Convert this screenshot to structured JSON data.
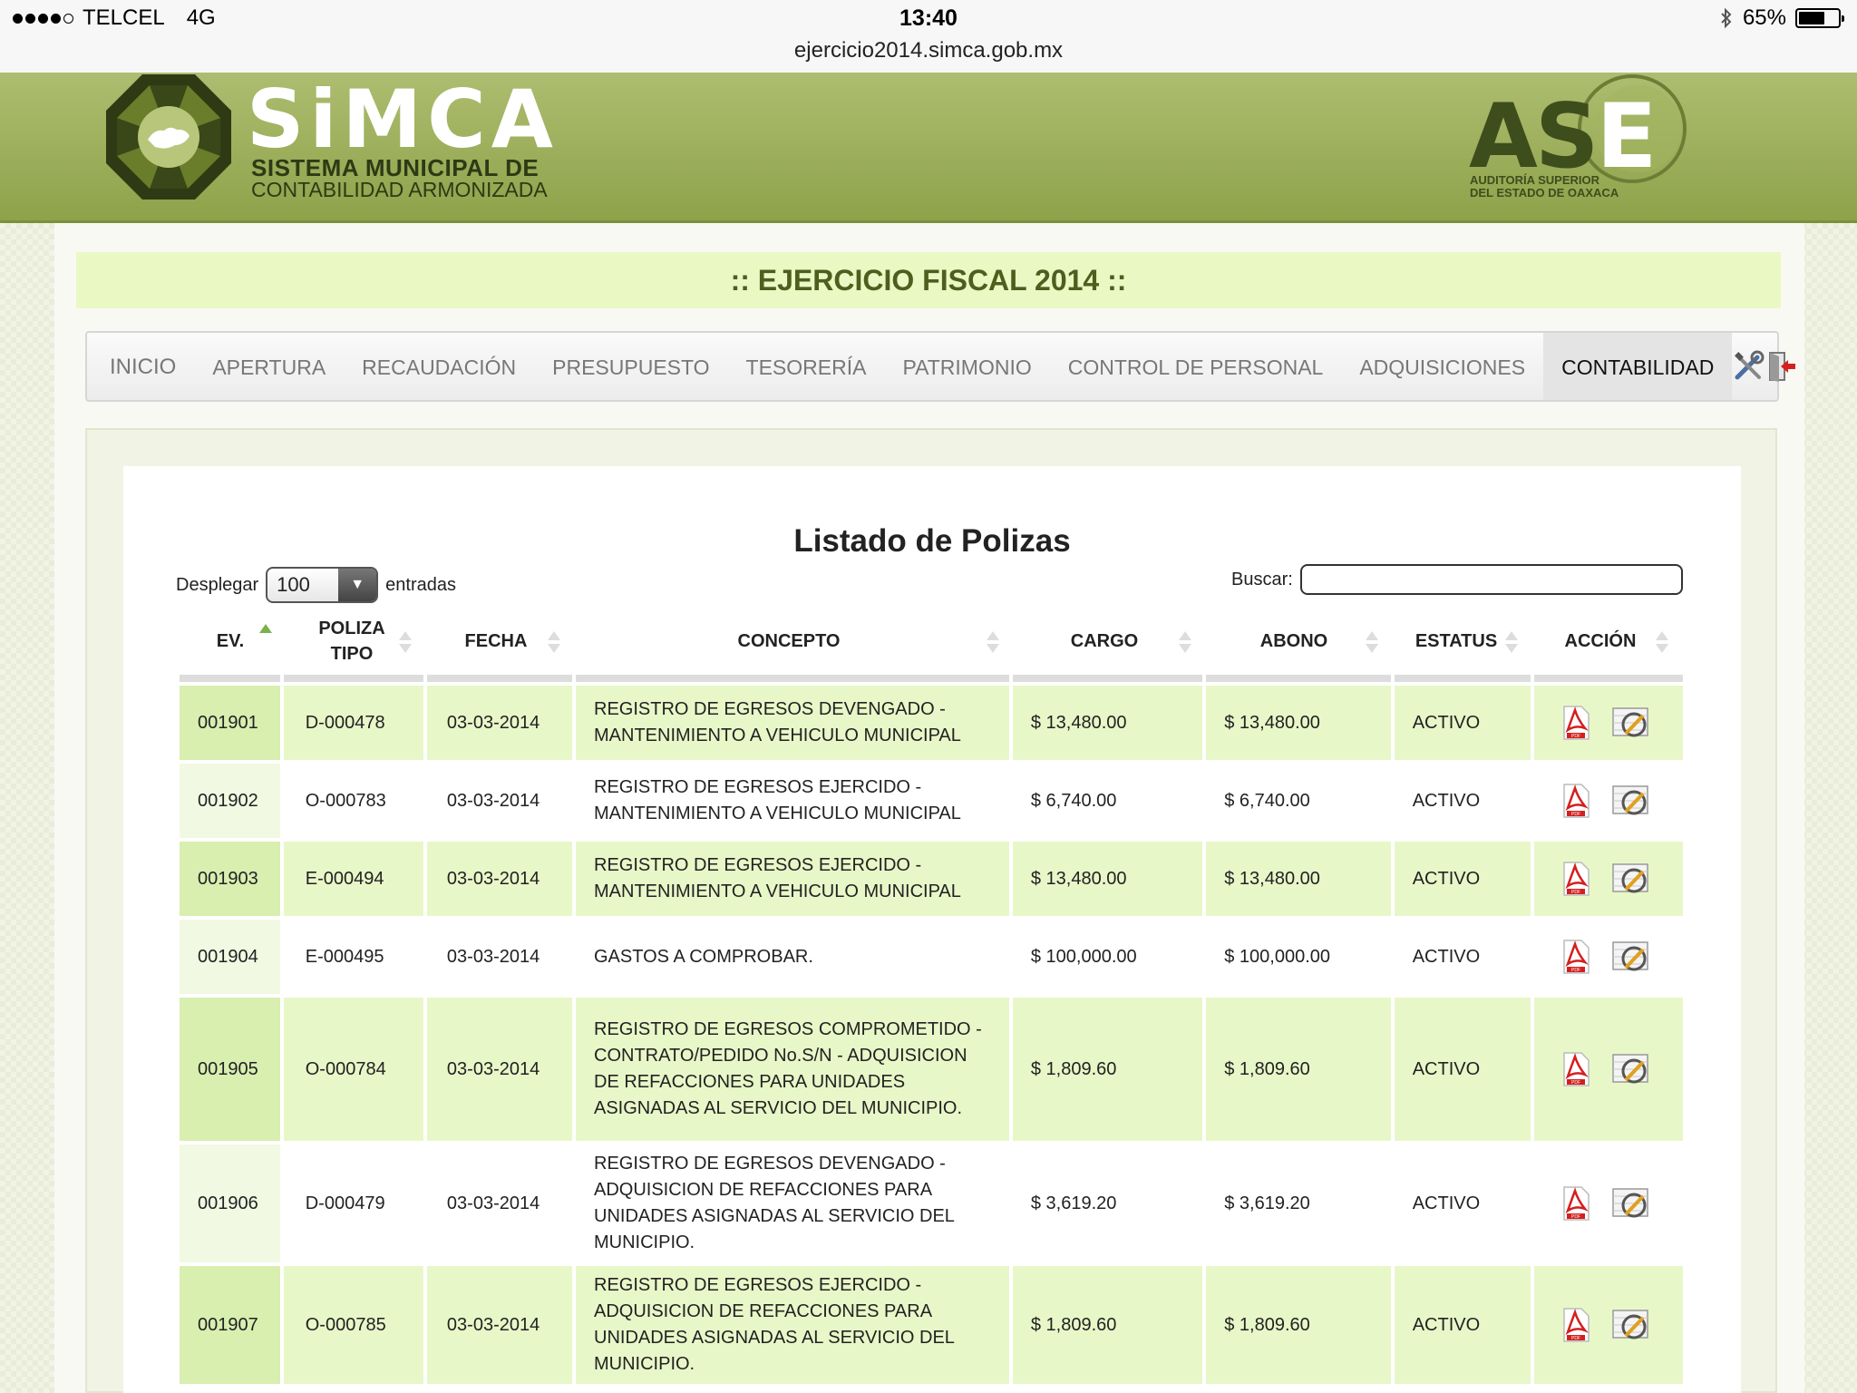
{
  "status_bar": {
    "carrier": "TELCEL",
    "network": "4G",
    "time": "13:40",
    "url": "ejercicio2014.simca.gob.mx",
    "battery": "65%"
  },
  "header": {
    "logo_title": "SiMCA",
    "logo_sub1": "SISTEMA MUNICIPAL DE",
    "logo_sub2": "CONTABILIDAD ARMONIZADA",
    "ase_word_a": "AS",
    "ase_word_e": "E",
    "ase_sub1": "AUDITORÍA SUPERIOR",
    "ase_sub2": "DEL ESTADO DE OAXACA"
  },
  "fiscal_banner": ":: EJERCICIO FISCAL 2014 ::",
  "nav": {
    "items": [
      "INICIO",
      "APERTURA",
      "RECAUDACIÓN",
      "PRESUPUESTO",
      "TESORERÍA",
      "PATRIMONIO",
      "CONTROL DE PERSONAL",
      "ADQUISICIONES",
      "CONTABILIDAD"
    ],
    "active": "CONTABILIDAD"
  },
  "list": {
    "title": "Listado de Polizas",
    "show_label": "Desplegar",
    "show_value": "100",
    "entries_label": "entradas",
    "search_label": "Buscar:",
    "search_value": ""
  },
  "table": {
    "headers": [
      "EV.",
      "POLIZA TIPO",
      "FECHA",
      "CONCEPTO",
      "CARGO",
      "ABONO",
      "ESTATUS",
      "ACCIÓN"
    ],
    "rows": [
      {
        "ev": "001901",
        "poliza": "D-000478",
        "fecha": "03-03-2014",
        "concepto": "REGISTRO DE EGRESOS DEVENGADO - MANTENIMIENTO A VEHICULO MUNICIPAL",
        "cargo": "$ 13,480.00",
        "abono": "$ 13,480.00",
        "estatus": "ACTIVO"
      },
      {
        "ev": "001902",
        "poliza": "O-000783",
        "fecha": "03-03-2014",
        "concepto": "REGISTRO DE EGRESOS EJERCIDO - MANTENIMIENTO A VEHICULO MUNICIPAL",
        "cargo": "$ 6,740.00",
        "abono": "$ 6,740.00",
        "estatus": "ACTIVO"
      },
      {
        "ev": "001903",
        "poliza": "E-000494",
        "fecha": "03-03-2014",
        "concepto": "REGISTRO DE EGRESOS EJERCIDO - MANTENIMIENTO A VEHICULO MUNICIPAL",
        "cargo": "$ 13,480.00",
        "abono": "$ 13,480.00",
        "estatus": "ACTIVO"
      },
      {
        "ev": "001904",
        "poliza": "E-000495",
        "fecha": "03-03-2014",
        "concepto": "GASTOS A COMPROBAR.",
        "cargo": "$ 100,000.00",
        "abono": "$ 100,000.00",
        "estatus": "ACTIVO"
      },
      {
        "ev": "001905",
        "poliza": "O-000784",
        "fecha": "03-03-2014",
        "concepto": "REGISTRO DE EGRESOS COMPROMETIDO - CONTRATO/PEDIDO No.S/N - ADQUISICION DE REFACCIONES PARA UNIDADES ASIGNADAS AL SERVICIO DEL MUNICIPIO.",
        "cargo": "$ 1,809.60",
        "abono": "$ 1,809.60",
        "estatus": "ACTIVO"
      },
      {
        "ev": "001906",
        "poliza": "D-000479",
        "fecha": "03-03-2014",
        "concepto": "REGISTRO DE EGRESOS DEVENGADO - ADQUISICION DE REFACCIONES PARA UNIDADES ASIGNADAS AL SERVICIO DEL MUNICIPIO.",
        "cargo": "$ 3,619.20",
        "abono": "$ 3,619.20",
        "estatus": "ACTIVO"
      },
      {
        "ev": "001907",
        "poliza": "O-000785",
        "fecha": "03-03-2014",
        "concepto": "REGISTRO DE EGRESOS EJERCIDO - ADQUISICION DE REFACCIONES PARA UNIDADES ASIGNADAS AL SERVICIO DEL MUNICIPIO.",
        "cargo": "$ 1,809.60",
        "abono": "$ 1,809.60",
        "estatus": "ACTIVO"
      }
    ]
  },
  "colors": {
    "header_green": "#9fb05c",
    "fiscal_banner_bg": "#eaf8c4",
    "row_odd_bg": "#e8f7c8"
  }
}
